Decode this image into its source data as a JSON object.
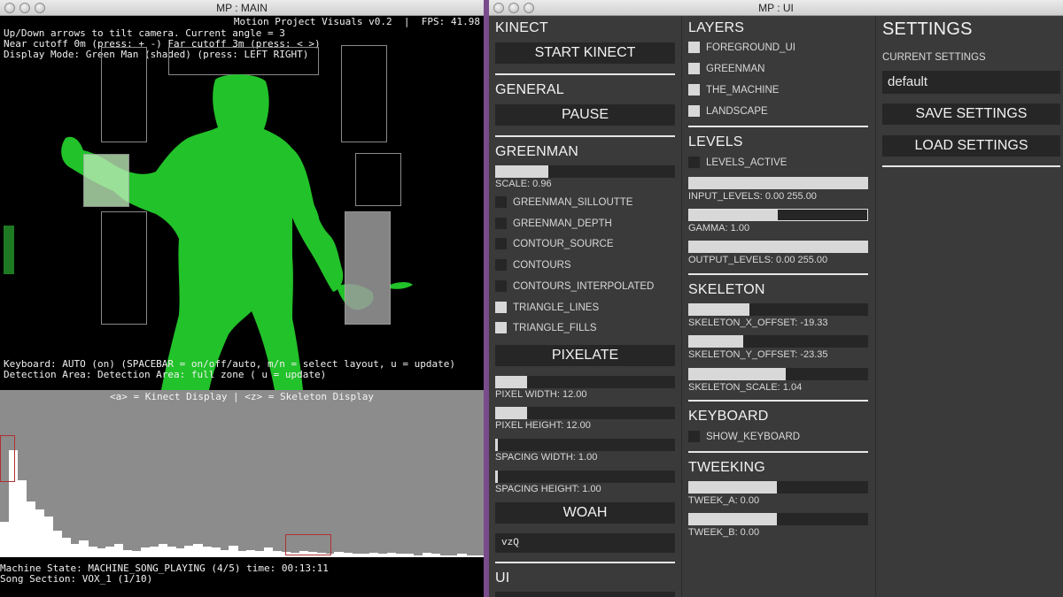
{
  "main_window": {
    "title": "MP : MAIN",
    "app_line": "Motion Project Visuals v0.2  |  FPS: 41.98",
    "overlay_lines": [
      "Up/Down arrows to tilt camera. Current angle = 3",
      "Near cutoff 0m (press: + -) Far cutoff 3m (press: < >)",
      "Display Mode: Green Man (shaded) (press: LEFT RIGHT)"
    ],
    "keyboard_line": "Keyboard: AUTO (on) (SPACEBAR = on/off/auto, m/n = select layout, u = update)",
    "detection_line": "Detection Area: Detection Area: full zone ( u = update)",
    "display_toggle": "<a> = Kinect Display | <z> = Skeleton Display",
    "machine_state": "Machine State: MACHINE_SONG_PLAYING (4/5) time: 00:13:11",
    "song_section": "Song Section: VOX_1 (1/10)",
    "figure_color": "#22c22a",
    "histogram": [
      0.33,
      1.0,
      0.72,
      0.52,
      0.45,
      0.38,
      0.25,
      0.18,
      0.12,
      0.16,
      0.1,
      0.08,
      0.1,
      0.12,
      0.07,
      0.06,
      0.09,
      0.1,
      0.12,
      0.1,
      0.08,
      0.11,
      0.12,
      0.1,
      0.09,
      0.07,
      0.11,
      0.06,
      0.07,
      0.06,
      0.09,
      0.06,
      0.05,
      0.04,
      0.06,
      0.05,
      0.04,
      0.03,
      0.05,
      0.04,
      0.03,
      0.03,
      0.04,
      0.03,
      0.04,
      0.03,
      0.03,
      0.02,
      0.04,
      0.03,
      0.02,
      0.02,
      0.03,
      0.02,
      0.02
    ]
  },
  "ui_window": {
    "title": "MP : UI",
    "kinect": {
      "header": "KINECT",
      "start_label": "START KINECT"
    },
    "general": {
      "header": "GENERAL",
      "pause_label": "PAUSE"
    },
    "greenman": {
      "header": "GREENMAN",
      "scale": {
        "label": "SCALE: 0.96",
        "value": 0.96
      },
      "toggles": [
        {
          "label": "GREENMAN_SILLOUTTE",
          "on": false
        },
        {
          "label": "GREENMAN_DEPTH",
          "on": false
        },
        {
          "label": "CONTOUR_SOURCE",
          "on": false
        },
        {
          "label": "CONTOURS",
          "on": false
        },
        {
          "label": "CONTOURS_INTERPOLATED",
          "on": false
        },
        {
          "label": "TRIANGLE_LINES",
          "on": true
        },
        {
          "label": "TRIANGLE_FILLS",
          "on": true
        }
      ]
    },
    "pixelate": {
      "header": "PIXELATE",
      "sliders": [
        {
          "label": "PIXEL WIDTH: 12.00",
          "value": 12.0
        },
        {
          "label": "PIXEL HEIGHT: 12.00",
          "value": 12.0
        },
        {
          "label": "SPACING WIDTH: 1.00",
          "value": 1.0
        },
        {
          "label": "SPACING HEIGHT: 1.00",
          "value": 1.0
        }
      ]
    },
    "woah": {
      "label": "WOAH",
      "field_value": "vzQ"
    },
    "ui_section": {
      "header": "UI"
    },
    "layers": {
      "header": "LAYERS",
      "items": [
        {
          "label": "FOREGROUND_UI",
          "on": false
        },
        {
          "label": "GREENMAN",
          "on": false
        },
        {
          "label": "THE_MACHINE",
          "on": false
        },
        {
          "label": "LANDSCAPE",
          "on": false
        }
      ]
    },
    "levels": {
      "header": "LEVELS",
      "active": {
        "label": "LEVELS_ACTIVE",
        "on": false
      },
      "input": {
        "label": "INPUT_LEVELS: 0.00 255.00",
        "low": 0.0,
        "high": 255.0
      },
      "gamma": {
        "label": "GAMMA: 1.00",
        "value": 1.0
      },
      "output": {
        "label": "OUTPUT_LEVELS: 0.00 255.00",
        "low": 0.0,
        "high": 255.0
      }
    },
    "skeleton": {
      "header": "SKELETON",
      "x_offset": {
        "label": "SKELETON_X_OFFSET: -19.33",
        "value": -19.33
      },
      "y_offset": {
        "label": "SKELETON_Y_OFFSET: -23.35",
        "value": -23.35
      },
      "scale": {
        "label": "SKELETON_SCALE: 1.04",
        "value": 1.04
      }
    },
    "keyboard": {
      "header": "KEYBOARD",
      "show": {
        "label": "SHOW_KEYBOARD",
        "on": false
      }
    },
    "tweeking": {
      "header": "TWEEKING",
      "a": {
        "label": "TWEEK_A: 0.00",
        "value": 0.0
      },
      "b": {
        "label": "TWEEK_B: 0.00",
        "value": 0.0
      }
    },
    "settings": {
      "header": "SETTINGS",
      "current_label": "CURRENT SETTINGS",
      "current_value": "default",
      "save_label": "SAVE SETTINGS",
      "load_label": "LOAD SETTINGS"
    }
  }
}
